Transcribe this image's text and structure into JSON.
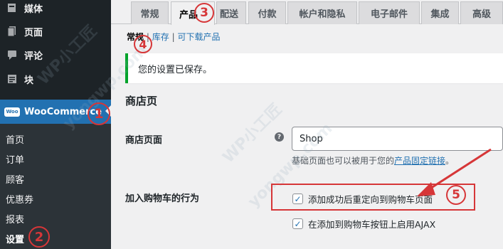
{
  "sidebar": {
    "items": [
      {
        "label": "媒体",
        "icon": "media-icon"
      },
      {
        "label": "页面",
        "icon": "page-icon"
      },
      {
        "label": "评论",
        "icon": "comment-icon"
      },
      {
        "label": "块",
        "icon": "block-icon"
      }
    ],
    "woocommerce": {
      "label": "WooCommerce",
      "logo_text": "Woo"
    },
    "submenu": [
      "首页",
      "订单",
      "顾客",
      "优惠券",
      "报表",
      "设置"
    ]
  },
  "tabs": [
    "常规",
    "产品",
    "配送",
    "付款",
    "帐户和隐私",
    "电子邮件",
    "集成",
    "高级"
  ],
  "subnav": {
    "items": [
      "常规",
      "库存",
      "可下载产品"
    ],
    "separator": "|"
  },
  "notice": "您的设置已保存。",
  "section_title": "商店页",
  "shop_page": {
    "label": "商店页面",
    "help": "?",
    "value": "Shop",
    "desc_prefix": "基础页面也可以被用于您的",
    "desc_link": "产品固定链接",
    "desc_suffix": "。"
  },
  "add_to_cart": {
    "label": "加入购物车的行为",
    "options": [
      {
        "label": "添加成功后重定向到购物车页面",
        "checked": true
      },
      {
        "label": "在添加到购物车按钮上启用AJAX",
        "checked": true
      }
    ]
  },
  "annotations": [
    "1",
    "2",
    "3",
    "4",
    "5"
  ],
  "watermark": [
    "WP小工匠",
    "yongwp.com"
  ],
  "colors": {
    "accent": "#2271b1",
    "annotation": "#d63638",
    "success": "#00a32a",
    "sidebar": "#1d2327"
  }
}
